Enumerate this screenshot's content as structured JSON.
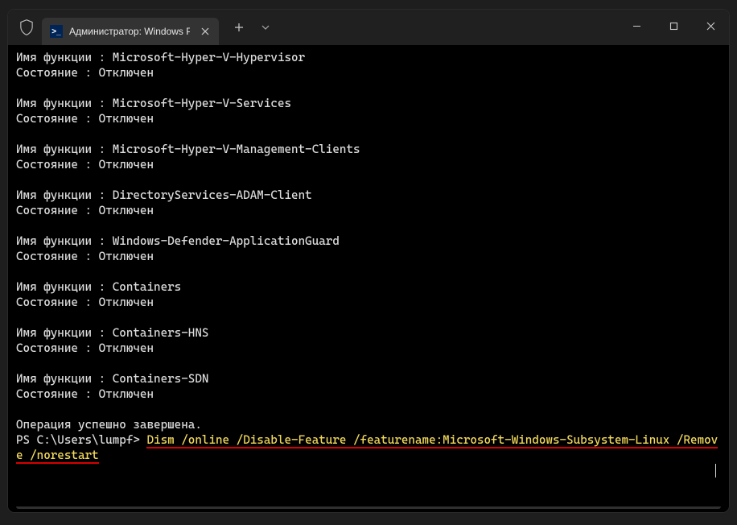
{
  "titlebar": {
    "tab_title": "Администратор: Windows Po",
    "tab_icon_glyph": ">_"
  },
  "features": [
    {
      "name": "Microsoft-Hyper-V-Hypervisor",
      "state": "Отключен"
    },
    {
      "name": "Microsoft-Hyper-V-Services",
      "state": "Отключен"
    },
    {
      "name": "Microsoft-Hyper-V-Management-Clients",
      "state": "Отключен"
    },
    {
      "name": "DirectoryServices-ADAM-Client",
      "state": "Отключен"
    },
    {
      "name": "Windows-Defender-ApplicationGuard",
      "state": "Отключен"
    },
    {
      "name": "Containers",
      "state": "Отключен"
    },
    {
      "name": "Containers-HNS",
      "state": "Отключен"
    },
    {
      "name": "Containers-SDN",
      "state": "Отключен"
    }
  ],
  "labels": {
    "feature_name": "Имя функции",
    "state": "Состояние"
  },
  "op_done": "Операция успешно завершена.",
  "prompt": "PS C:\\Users\\lumpf>",
  "command": "Dism /online /Disable-Feature /featurename:Microsoft-Windows-Subsystem-Linux /Remove /norestart"
}
